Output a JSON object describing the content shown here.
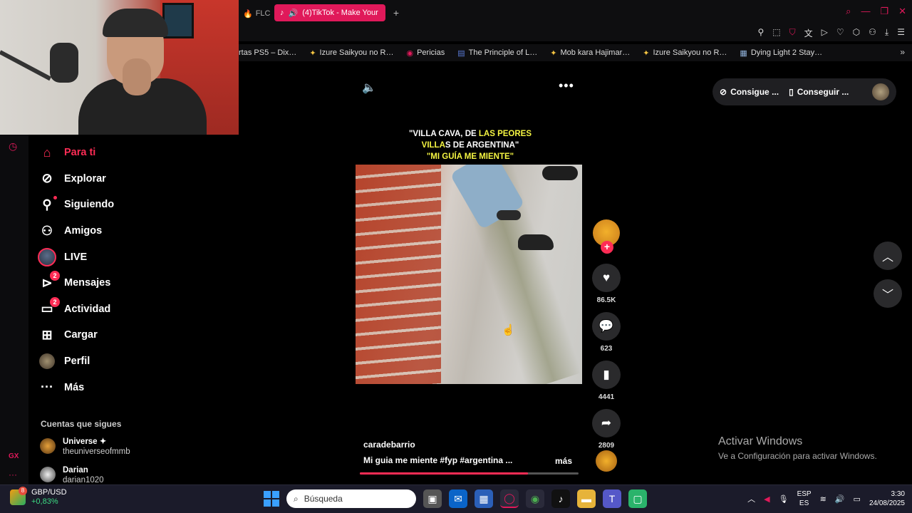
{
  "browser": {
    "tab_inactive": "FLC",
    "tab_active": "(4)TikTok - Make Your",
    "tab_add": "+"
  },
  "bookmarks": [
    {
      "label": "rtas PS5 – Dix…",
      "icon": "bookmark-icon"
    },
    {
      "label": "Izure Saikyou no R…",
      "icon": "star-icon"
    },
    {
      "label": "Pericias",
      "icon": "globe-icon"
    },
    {
      "label": "The Principle of L…",
      "icon": "page-icon"
    },
    {
      "label": "Mob kara Hajimar…",
      "icon": "star-icon"
    },
    {
      "label": "Izure Saikyou no R…",
      "icon": "star-icon"
    },
    {
      "label": "Dying Light 2 Stay…",
      "icon": "game-icon"
    }
  ],
  "sidebar": {
    "items": [
      {
        "label": "Para ti",
        "icon": "home-icon",
        "active": true
      },
      {
        "label": "Explorar",
        "icon": "compass-icon"
      },
      {
        "label": "Siguiendo",
        "icon": "following-icon"
      },
      {
        "label": "Amigos",
        "icon": "friends-icon"
      },
      {
        "label": "LIVE",
        "icon": "live-icon"
      },
      {
        "label": "Mensajes",
        "icon": "messages-icon",
        "badge": "2"
      },
      {
        "label": "Actividad",
        "icon": "activity-icon",
        "badge": "2"
      },
      {
        "label": "Cargar",
        "icon": "upload-icon"
      },
      {
        "label": "Perfil",
        "icon": "profile-icon"
      },
      {
        "label": "Más",
        "icon": "more-icon"
      }
    ],
    "following_title": "Cuentas que sigues",
    "accounts": [
      {
        "name": "Universe ✦",
        "handle": "theuniverseofmmb"
      },
      {
        "name": "Darian",
        "handle": "darian1020"
      }
    ]
  },
  "video": {
    "caption_line1_a": "\"VILLA CAVA, DE ",
    "caption_line1_b": "LAS PEORES",
    "caption_line2_a": "VILLA",
    "caption_line2_b": "S DE ARGENTINA\"",
    "caption_line3": "\"MI GUÍA ME MIENTE\"",
    "username": "caradebarrio",
    "description": "Mi guia me miente #fyp  #argentina  ...",
    "more_label": "más",
    "progress": 0.77,
    "likes": "86.5K",
    "comments": "623",
    "saves": "4441",
    "shares": "2809"
  },
  "top_pills": {
    "pill1": "Consigue ...",
    "pill2": "Conseguir ..."
  },
  "watermark": {
    "title": "Activar Windows",
    "subtitle": "Ve a Configuración para activar Windows."
  },
  "taskbar": {
    "stock_symbol": "GBP/USD",
    "stock_change": "+0,83%",
    "stock_badge": "8",
    "search_placeholder": "Búsqueda",
    "lang_top": "ESP",
    "lang_bottom": "ES",
    "time": "3:30",
    "date": "24/08/2025"
  },
  "colors": {
    "accent": "#fe2c55",
    "browser_accent": "#e0195a"
  }
}
